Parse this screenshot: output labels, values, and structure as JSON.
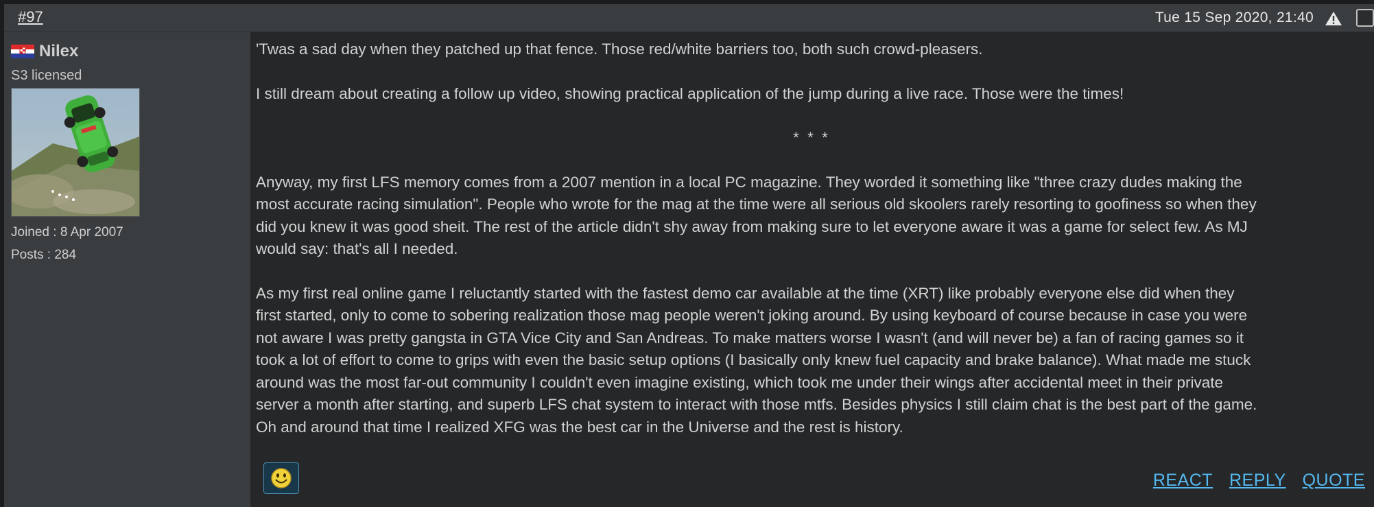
{
  "post": {
    "number": "#97",
    "date": "Tue 15 Sep 2020, 21:40",
    "icons": {
      "report": "warning-triangle-icon",
      "select": "select-checkbox-icon"
    }
  },
  "author": {
    "name": "Nilex",
    "title": "S3 licensed",
    "joined": "Joined : 8 Apr 2007",
    "posts": "Posts : 284",
    "flag": "croatia-flag-icon",
    "avatar": "avatar-image"
  },
  "body": {
    "paragraphs": [
      [
        "'Twas a sad day when they patched up that fence. Those red/white barriers too, both such crowd-pleasers."
      ],
      [
        "I still dream about creating a follow up video, showing practical application of the jump during a live race. Those were the times!"
      ],
      [
        "Anyway, my first LFS memory comes from a 2007 mention in a local PC magazine. They worded it something like \"three crazy dudes making the",
        "most accurate racing simulation\". People who wrote for the mag at the time were all serious old skoolers rarely resorting to goofiness so when they",
        "did you knew it was good sheit. The rest of the article didn't shy away from making sure to let everyone aware it was a game for select few. As MJ",
        "would say: that's all I needed."
      ],
      [
        "As my first real online game I reluctantly started with the fastest demo car available at the time (XRT) like probably everyone else did when they",
        "first started, only to come to sobering realization those mag people weren't joking around. By using keyboard of course because in case you were",
        "not aware I was pretty gangsta in GTA Vice City and San Andreas. To make matters worse I wasn't (and will never be) a fan of racing games so it",
        "took a lot of effort to come to grips with even the basic setup options (I basically only knew fuel capacity and brake balance). What made me stuck",
        "around was the most far-out community I couldn't even imagine existing, which took me under their wings after accidental meet in their private",
        "server a month after starting, and superb LFS chat system to interact with those mtfs. Besides physics I still claim chat is the best part of the game.",
        "Oh and around that time I realized XFG was the best car in the Universe and the rest is history."
      ]
    ],
    "separator": "* * *"
  },
  "actions": {
    "react": "REACT",
    "reply": "REPLY",
    "quote": "QUOTE",
    "emoji_icon": "smiley-icon"
  },
  "colors": {
    "link": "#55b9f0",
    "header_bg": "#3a3d40",
    "content_bg": "#252729",
    "emoji_btn_bg": "#18384a"
  }
}
